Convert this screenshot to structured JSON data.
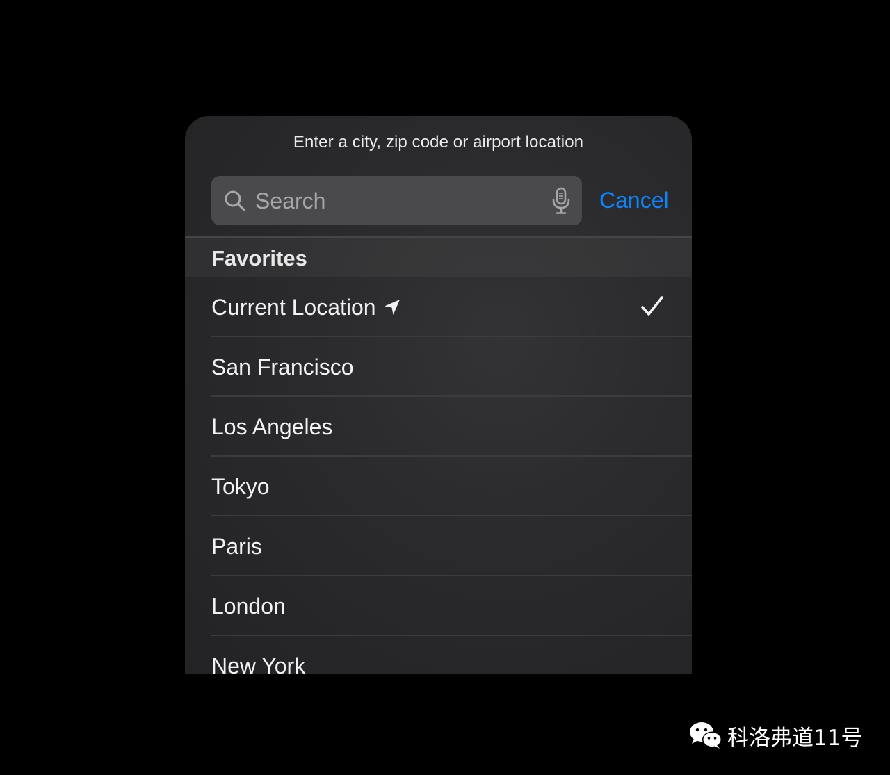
{
  "location_picker": {
    "prompt": "Enter a city, zip code or airport location",
    "search": {
      "placeholder": "Search",
      "search_icon": "magnifying-glass-icon",
      "mic_icon": "microphone-icon"
    },
    "cancel_label": "Cancel",
    "section_title": "Favorites",
    "items": [
      {
        "label": "Current Location",
        "icon": "location-arrow-icon",
        "selected": true
      },
      {
        "label": "San Francisco"
      },
      {
        "label": "Los Angeles"
      },
      {
        "label": "Tokyo"
      },
      {
        "label": "Paris"
      },
      {
        "label": "London"
      },
      {
        "label": "New York"
      }
    ]
  },
  "watermark": {
    "text": "科洛弗道11号",
    "icon": "wechat-icon"
  },
  "colors": {
    "accent": "#0a84ff",
    "background": "#000000",
    "panel": "#2a2a2c",
    "search_field": "#4a4a4d"
  }
}
